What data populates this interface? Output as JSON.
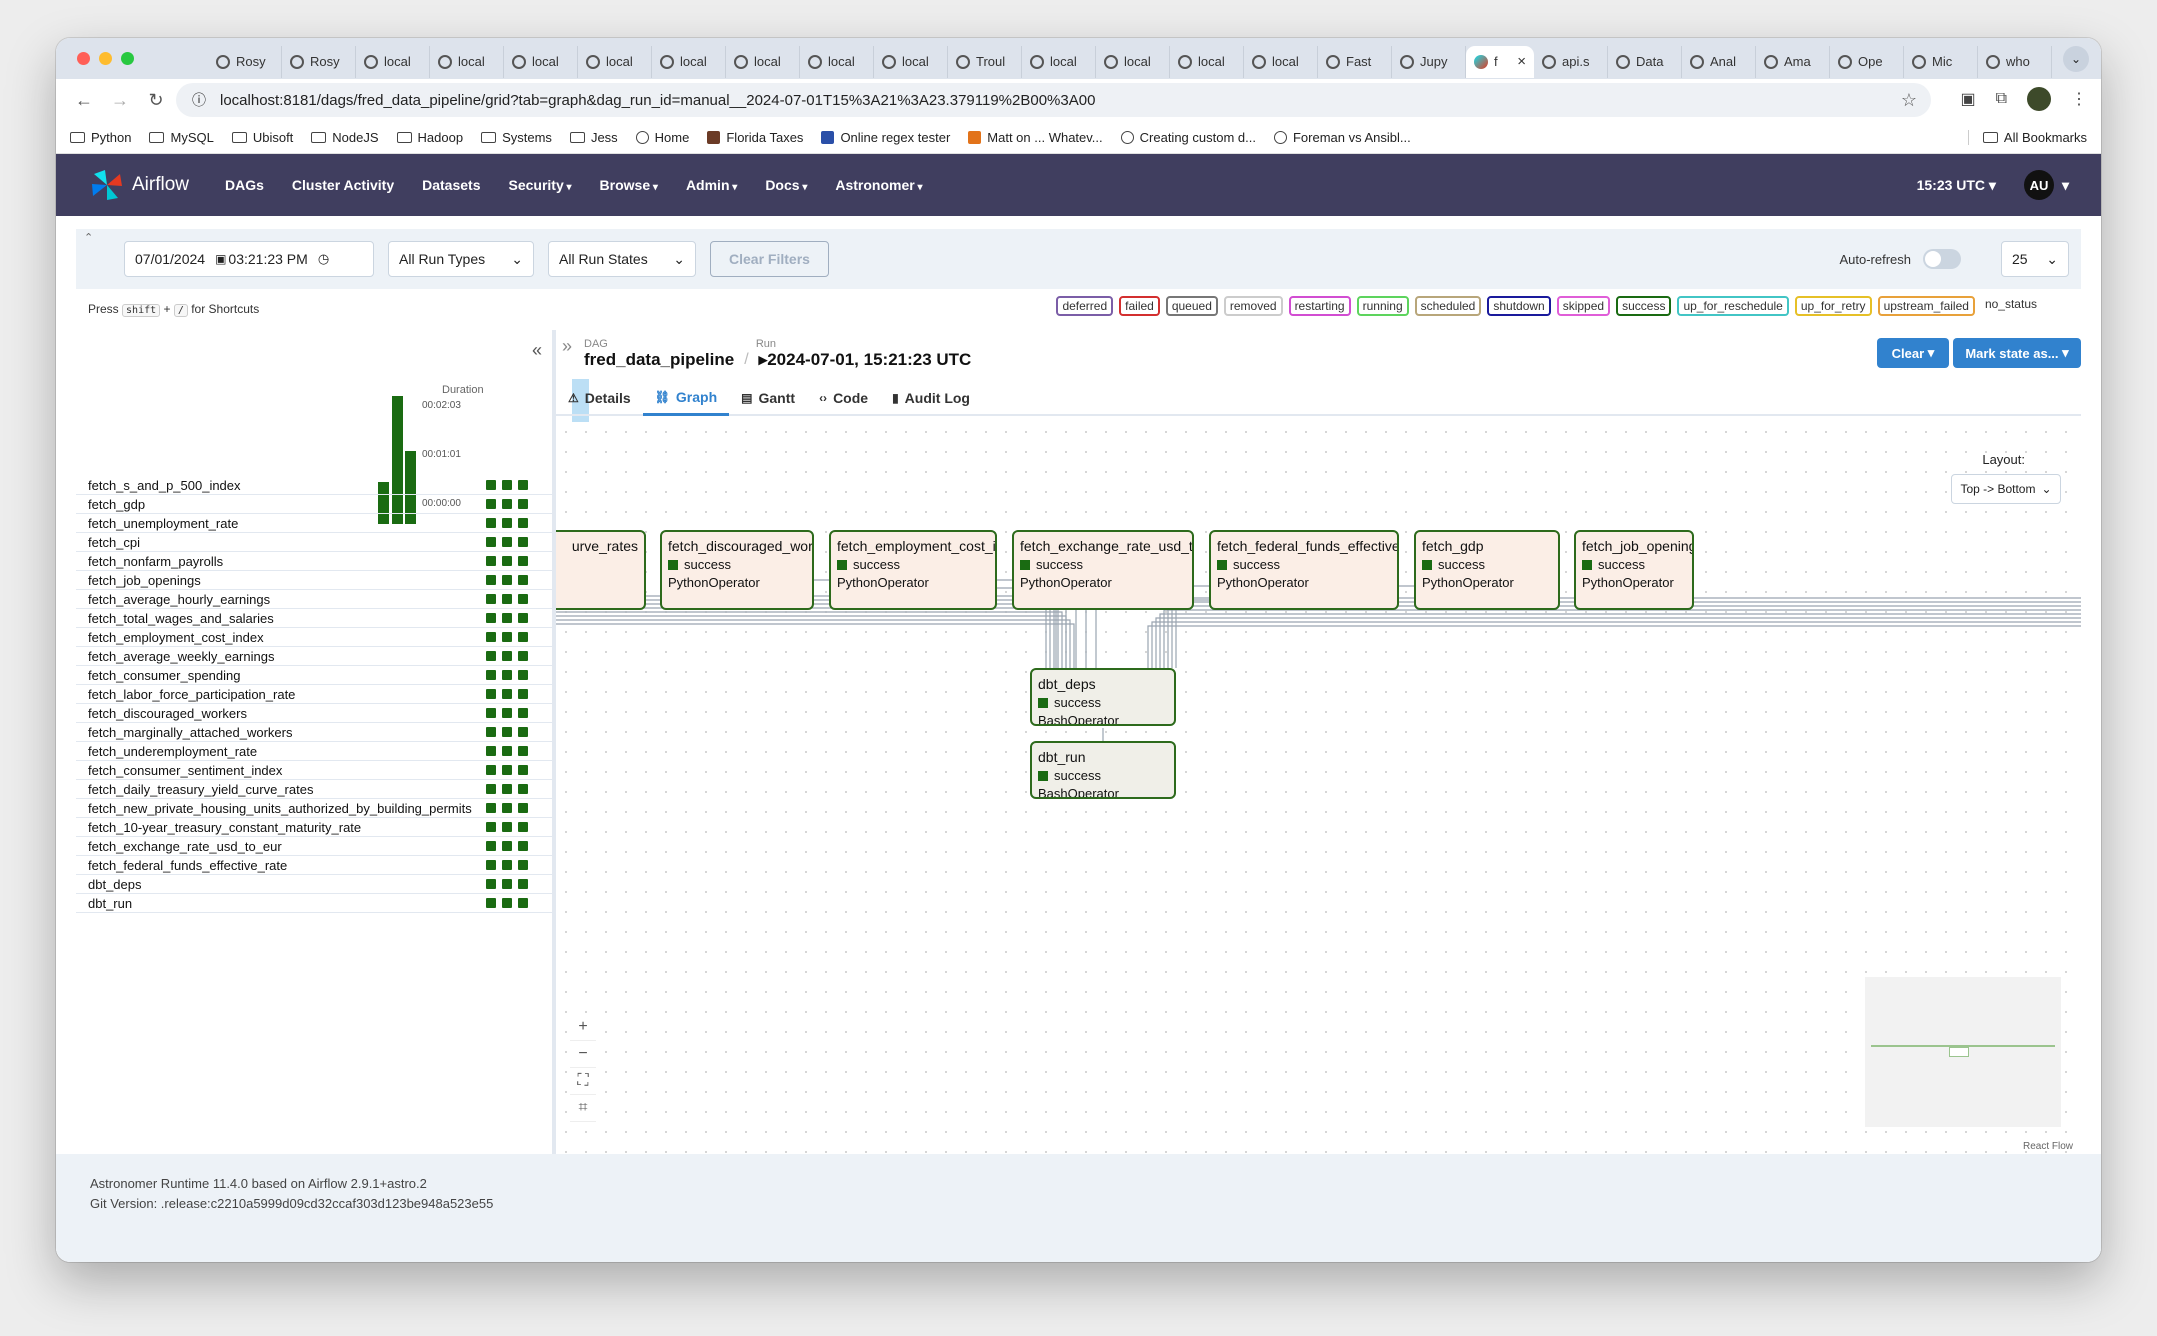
{
  "browser": {
    "tabs": [
      {
        "label": "Rosy"
      },
      {
        "label": "Rosy"
      },
      {
        "label": "local"
      },
      {
        "label": "local"
      },
      {
        "label": "local"
      },
      {
        "label": "local"
      },
      {
        "label": "local"
      },
      {
        "label": "local"
      },
      {
        "label": "local"
      },
      {
        "label": "local"
      },
      {
        "label": "Troul"
      },
      {
        "label": "local"
      },
      {
        "label": "local"
      },
      {
        "label": "local"
      },
      {
        "label": "local"
      },
      {
        "label": "Fast"
      },
      {
        "label": "Jupy"
      },
      {
        "label": "f",
        "active": true
      },
      {
        "label": "api.s"
      },
      {
        "label": "Data"
      },
      {
        "label": "Anal"
      },
      {
        "label": "Ama"
      },
      {
        "label": "Ope"
      },
      {
        "label": "Mic"
      },
      {
        "label": "who"
      }
    ],
    "url": "localhost:8181/dags/fred_data_pipeline/grid?tab=graph&dag_run_id=manual__2024-07-01T15%3A21%3A23.379119%2B00%3A00",
    "bookmarks": [
      {
        "label": "Python",
        "icon": "folder"
      },
      {
        "label": "MySQL",
        "icon": "folder"
      },
      {
        "label": "Ubisoft",
        "icon": "folder"
      },
      {
        "label": "NodeJS",
        "icon": "folder"
      },
      {
        "label": "Hadoop",
        "icon": "folder"
      },
      {
        "label": "Systems",
        "icon": "folder"
      },
      {
        "label": "Jess",
        "icon": "folder"
      },
      {
        "label": "Home",
        "icon": "globe"
      },
      {
        "label": "Florida Taxes",
        "icon": "brown"
      },
      {
        "label": "Online regex tester",
        "icon": "blue"
      },
      {
        "label": "Matt on ... Whatev...",
        "icon": "orange"
      },
      {
        "label": "Creating custom d...",
        "icon": "globe"
      },
      {
        "label": "Foreman vs Ansibl...",
        "icon": "globe"
      }
    ],
    "all_bookmarks": "All Bookmarks"
  },
  "nav": {
    "brand": "Airflow",
    "items": [
      "DAGs",
      "Cluster Activity",
      "Datasets",
      "Security",
      "Browse",
      "Admin",
      "Docs",
      "Astronomer"
    ],
    "time": "15:23 UTC",
    "avatar": "AU"
  },
  "filters": {
    "date": "07/01/2024",
    "time": "03:21:23 PM",
    "run_types": "All Run Types",
    "run_states": "All Run States",
    "clear": "Clear Filters",
    "auto_refresh": "Auto-refresh",
    "page_size": "25"
  },
  "shortcuts": {
    "press": "Press",
    "key1": "shift",
    "plus": "+",
    "key2": "/",
    "suffix": "for Shortcuts"
  },
  "legend": [
    {
      "label": "deferred",
      "color": "#7b5ea7"
    },
    {
      "label": "failed",
      "color": "#d32f2f"
    },
    {
      "label": "queued",
      "color": "#777777"
    },
    {
      "label": "removed",
      "color": "#cccccc"
    },
    {
      "label": "restarting",
      "color": "#d24dd2"
    },
    {
      "label": "running",
      "color": "#5dd45d"
    },
    {
      "label": "scheduled",
      "color": "#b8a67a"
    },
    {
      "label": "shutdown",
      "color": "#1a1a9c"
    },
    {
      "label": "skipped",
      "color": "#e05ed8"
    },
    {
      "label": "success",
      "color": "#1a6b12"
    },
    {
      "label": "up_for_reschedule",
      "color": "#42c5c5"
    },
    {
      "label": "up_for_retry",
      "color": "#e6c027"
    },
    {
      "label": "upstream_failed",
      "color": "#e8a13a"
    },
    {
      "label": "no_status",
      "color": "#ffffff"
    }
  ],
  "grid": {
    "duration_label": "Duration",
    "ticks": [
      "00:02:03",
      "00:01:01",
      "00:00:00"
    ],
    "run_durations": [
      0.33,
      1.0,
      0.57
    ],
    "tasks": [
      "fetch_s_and_p_500_index",
      "fetch_gdp",
      "fetch_unemployment_rate",
      "fetch_cpi",
      "fetch_nonfarm_payrolls",
      "fetch_job_openings",
      "fetch_average_hourly_earnings",
      "fetch_total_wages_and_salaries",
      "fetch_employment_cost_index",
      "fetch_average_weekly_earnings",
      "fetch_consumer_spending",
      "fetch_labor_force_participation_rate",
      "fetch_discouraged_workers",
      "fetch_marginally_attached_workers",
      "fetch_underemployment_rate",
      "fetch_consumer_sentiment_index",
      "fetch_daily_treasury_yield_curve_rates",
      "fetch_new_private_housing_units_authorized_by_building_permits",
      "fetch_10-year_treasury_constant_maturity_rate",
      "fetch_exchange_rate_usd_to_eur",
      "fetch_federal_funds_effective_rate",
      "dbt_deps",
      "dbt_run"
    ]
  },
  "detail": {
    "dag_label": "DAG",
    "dag_id": "fred_data_pipeline",
    "run_label": "Run",
    "run_id": "2024-07-01, 15:21:23 UTC",
    "clear_btn": "Clear",
    "mark_btn": "Mark state as...",
    "tabs": [
      "Details",
      "Graph",
      "Gantt",
      "Code",
      "Audit Log"
    ],
    "layout_label": "Layout:",
    "layout_value": "Top -> Bottom",
    "react_flow": "React Flow"
  },
  "graph_nodes": [
    {
      "name": "urve_rates",
      "state": "success",
      "operator": ""
    },
    {
      "name": "fetch_discouraged_workers",
      "state": "success",
      "operator": "PythonOperator"
    },
    {
      "name": "fetch_employment_cost_index",
      "state": "success",
      "operator": "PythonOperator"
    },
    {
      "name": "fetch_exchange_rate_usd_to_eur",
      "state": "success",
      "operator": "PythonOperator"
    },
    {
      "name": "fetch_federal_funds_effective_rate",
      "state": "success",
      "operator": "PythonOperator"
    },
    {
      "name": "fetch_gdp",
      "state": "success",
      "operator": "PythonOperator"
    },
    {
      "name": "fetch_job_openings",
      "state": "success",
      "operator": "PythonOperator"
    },
    {
      "name": "dbt_deps",
      "state": "success",
      "operator": "BashOperator"
    },
    {
      "name": "dbt_run",
      "state": "success",
      "operator": "BashOperator"
    }
  ],
  "footer": {
    "runtime": "Astronomer Runtime 11.4.0 based on Airflow 2.9.1+astro.2",
    "git": "Git Version: .release:c2210a5999d09cd32ccaf303d123be948a523e55"
  }
}
